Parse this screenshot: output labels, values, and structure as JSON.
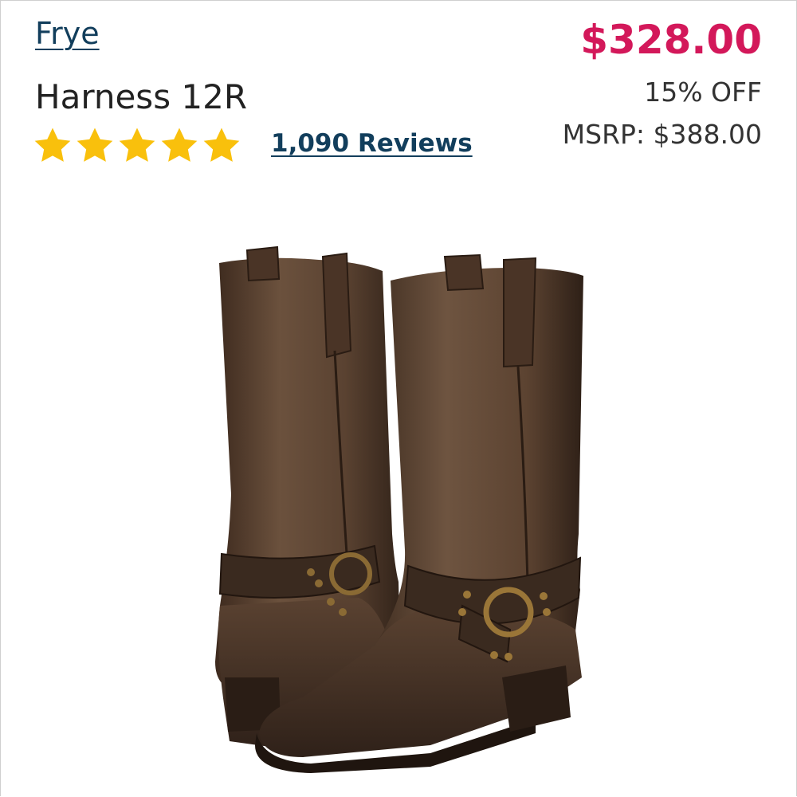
{
  "product": {
    "brand": "Frye",
    "name": "Harness 12R",
    "rating": 5,
    "rating_max": 5,
    "reviews_label": "1,090 Reviews"
  },
  "pricing": {
    "price": "$328.00",
    "discount": "15% OFF",
    "msrp": "MSRP: $388.00"
  },
  "colors": {
    "link": "#123e5c",
    "price": "#d3185a",
    "star": "#f9c00c",
    "leather": "#4a3426"
  },
  "image": {
    "icon": "boots-product-photo"
  }
}
